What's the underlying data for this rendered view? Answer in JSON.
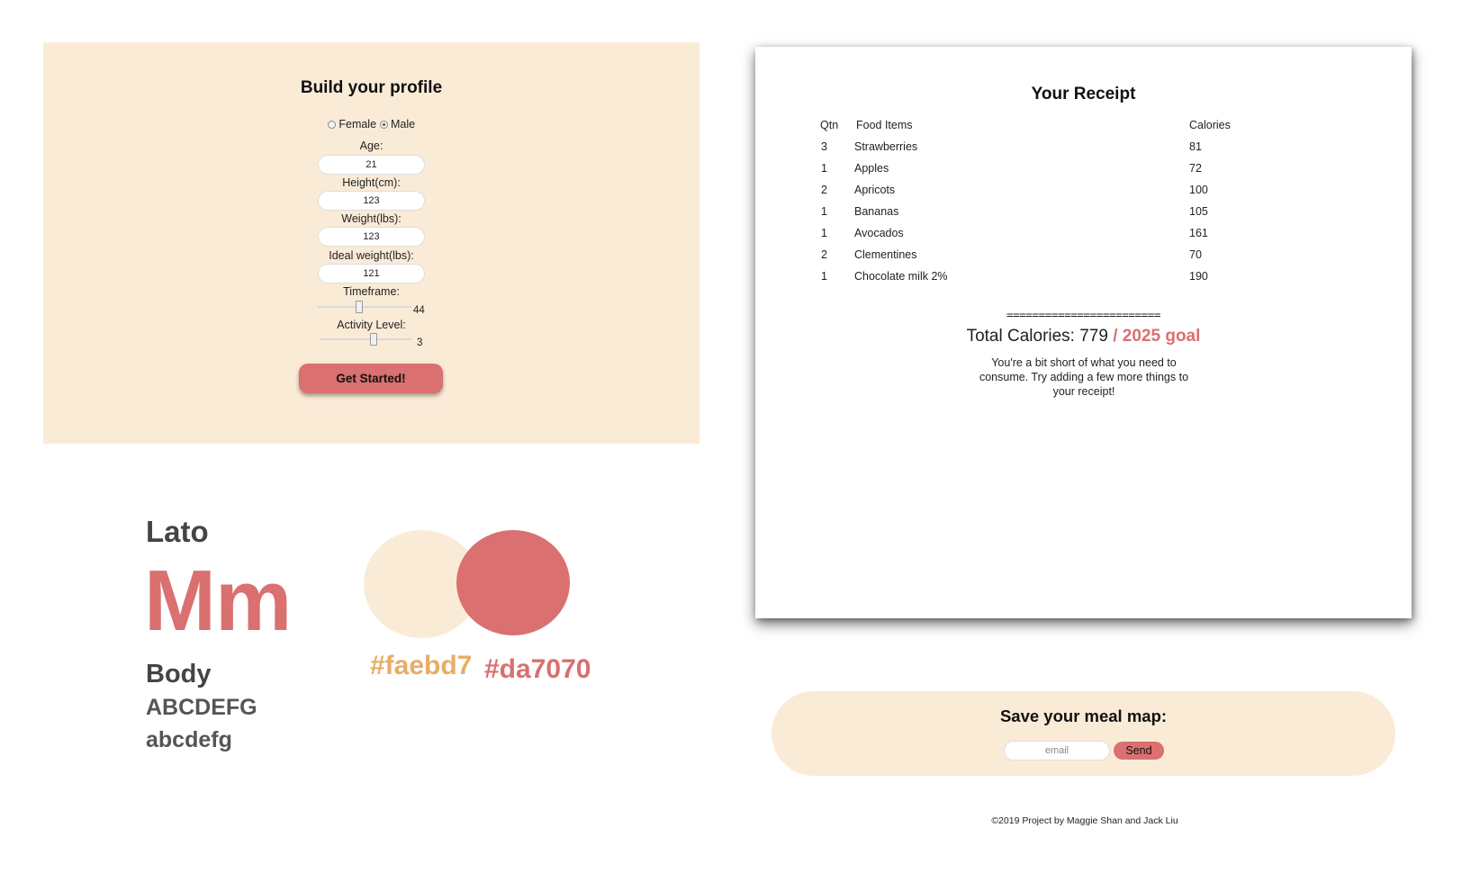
{
  "profile": {
    "title": "Build your profile",
    "gender_options": [
      {
        "label": "Female",
        "selected": false
      },
      {
        "label": "Male",
        "selected": true
      }
    ],
    "fields": [
      {
        "label": "Age:",
        "value": "21"
      },
      {
        "label": "Height(cm):",
        "value": "123"
      },
      {
        "label": "Weight(lbs):",
        "value": "123"
      },
      {
        "label": "Ideal weight(lbs):",
        "value": "121"
      }
    ],
    "sliders": [
      {
        "label": "Timeframe:",
        "value": "44",
        "fraction": 0.44
      },
      {
        "label": "Activity Level:",
        "value": "3",
        "fraction": 0.6
      }
    ],
    "submit_label": "Get Started!"
  },
  "style_guide": {
    "font_name": "Lato",
    "specimen": "Mm",
    "body_label": "Body",
    "uppercase": "ABCDEFG",
    "lowercase": "abcdefg",
    "swatches": [
      {
        "hex": "#faebd7",
        "label": "#faebd7"
      },
      {
        "hex": "#da7070",
        "label": "#da7070"
      }
    ]
  },
  "receipt": {
    "title": "Your Receipt",
    "columns": [
      "Qtn",
      "Food Items",
      "Calories"
    ],
    "rows": [
      {
        "qty": "3",
        "item": "Strawberries",
        "calories": "81"
      },
      {
        "qty": "1",
        "item": "Apples",
        "calories": "72"
      },
      {
        "qty": "2",
        "item": "Apricots",
        "calories": "100"
      },
      {
        "qty": "1",
        "item": "Bananas",
        "calories": "105"
      },
      {
        "qty": "1",
        "item": "Avocados",
        "calories": "161"
      },
      {
        "qty": "2",
        "item": "Clementines",
        "calories": "70"
      },
      {
        "qty": "1",
        "item": "Chocolate milk 2%",
        "calories": "190"
      }
    ],
    "divider": "========================",
    "total_label": "Total Calories: 779",
    "goal_label": "/ 2025 goal",
    "message": "You're a bit short of what you need to consume. Try adding a few more things to your receipt!"
  },
  "save": {
    "title": "Save your meal map:",
    "email_placeholder": "email",
    "send_label": "Send"
  },
  "footer": "©2019 Project by Maggie Shan and Jack Liu"
}
